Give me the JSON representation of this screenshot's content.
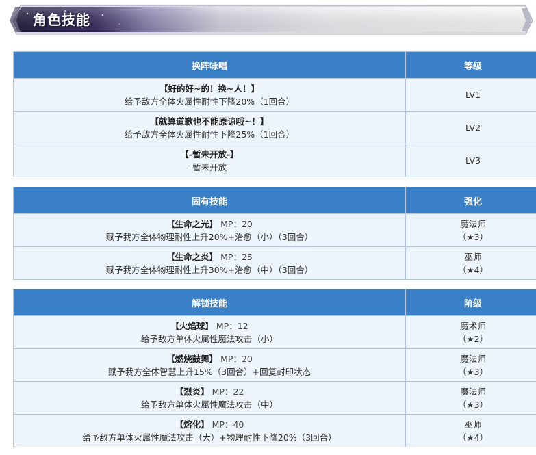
{
  "banner": {
    "title": "角色技能"
  },
  "colors": {
    "header_bg": "#3a80c7",
    "cell_bg": "#eef4fb",
    "border": "#b4c6dc",
    "banner_dark": "#2b2550"
  },
  "table1": {
    "headers": [
      "换阵咏唱",
      "等级"
    ],
    "rows": [
      {
        "name": "【好的好~的！换~人！】",
        "desc": "给予敌方全体火属性耐性下降20%（1回合）",
        "level": "LV1"
      },
      {
        "name": "【就算道歉也不能原谅哦~！】",
        "desc": "给予敌方全体火属性耐性下降25%（1回合）",
        "level": "LV2"
      },
      {
        "name": "【-暂未开放-】",
        "desc": "-暂未开放-",
        "level": "LV3"
      }
    ]
  },
  "table2": {
    "headers": [
      "固有技能",
      "强化"
    ],
    "rows": [
      {
        "name": "【生命之光】",
        "mp": "MP：20",
        "desc": "赋予我方全体物理耐性上升20%+治愈（小）（3回合）",
        "class": "魔法师",
        "stars": "（★3）"
      },
      {
        "name": "【生命之炎】",
        "mp": "MP：25",
        "desc": "赋予我方全体物理耐性上升30%+治愈（中）（3回合）",
        "class": "巫师",
        "stars": "（★4）"
      }
    ]
  },
  "table3": {
    "headers": [
      "解锁技能",
      "阶级"
    ],
    "rows": [
      {
        "name": "【火焰球】",
        "mp": "MP：12",
        "desc": "给予敌方单体火属性魔法攻击（小）",
        "class": "魔术师",
        "stars": "（★2）"
      },
      {
        "name": "【燃烧鼓舞】",
        "mp": "MP：20",
        "desc": "赋予我方全体智慧上升15%（3回合）+回复封印状态",
        "class": "魔法师",
        "stars": "（★3）"
      },
      {
        "name": "【烈炎】",
        "mp": "MP：22",
        "desc": "给予敌方单体火属性魔法攻击（中）",
        "class": "魔法师",
        "stars": "（★3）"
      },
      {
        "name": "【熔化】",
        "mp": "MP：40",
        "desc": "给予敌方单体火属性魔法攻击（大）+物理耐性下降20%（3回合）",
        "class": "巫师",
        "stars": "（★4）"
      }
    ]
  }
}
